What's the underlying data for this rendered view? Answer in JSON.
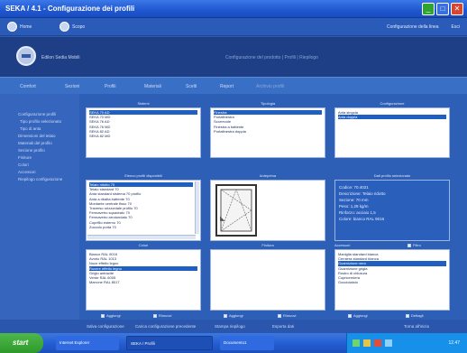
{
  "window": {
    "title": "SEKA / 4.1 - Configurazione dei profili"
  },
  "toolbar": {
    "items": [
      "Home",
      "Scopo"
    ],
    "right": [
      "Configurazione della linea",
      "Esci"
    ]
  },
  "header": {
    "brand": "Edilon Sedia Mobili",
    "info": "Configurazione del prodotto  |  Profili  |  Riepilogo"
  },
  "menu": {
    "items": [
      "Comfort",
      "Sezioni",
      "Profili",
      "Materiali",
      "Scelti",
      "Report",
      "Archivio profili"
    ]
  },
  "sidebar": {
    "items": [
      "Configurazione profili",
      "Tipo profilo selezionato",
      "Tipo di anta",
      "Dimensioni del telaio",
      "Materiali del profilo",
      "Sezione profilo",
      "Finiture",
      "Colori",
      "Accessori",
      "Riepilogo configurazione"
    ]
  },
  "panels": {
    "p1": {
      "label": "Sistemi",
      "items": [
        "SEKA 70 AD",
        "SEKA 70 MD",
        "SEKA 76 AD",
        "SEKA 76 MD",
        "SEKA 82 AD",
        "SEKA 82 MD"
      ],
      "selected": 0
    },
    "p2": {
      "label": "Tipologia",
      "items": [
        "Finestra",
        "Portafinestra",
        "Scorrevole",
        "Finestra a battente",
        "Portafinestra doppia"
      ],
      "selected": 0
    },
    "p3": {
      "label": "Configurazione",
      "items": [
        "Anta singola",
        "Anta doppia"
      ],
      "selected": 1
    },
    "p4": {
      "label": "Elenco profili disponibili",
      "items": [
        "Telaio ridotto 70",
        "Telaio standard 70",
        "Anta standard sistema 70 profilo",
        "Anta a ribalta battente 70",
        "Montante centrale fisso 70",
        "Traverso orizzontale profilo 70",
        "Fermavetro squadrato 70",
        "Fermavetro arrotondato 70",
        "Coprifilo esterno 70",
        "Zoccolo porta 70"
      ],
      "selected": 0
    },
    "p5": {
      "label": "Anteprima",
      "glyph": "◣"
    },
    "p6": {
      "label": "Dati profilo selezionato",
      "lines": [
        "Codice: 70.4021",
        "Descrizione: Telaio ridotto",
        "Sezione: 70 mm",
        "Peso: 1,28 kg/m",
        "Rinforzo: acciaio 1,5",
        "Colore: bianco RAL 9016"
      ]
    },
    "p7": {
      "label": "Colori",
      "items": [
        "Bianco RAL 9016",
        "Avorio RAL 1013",
        "Noce effetto legno",
        "Rovere effetto legno",
        "Grigio antracite",
        "Verde RAL 6005",
        "Marrone RAL 8017"
      ],
      "selected": 3
    },
    "p8": {
      "label": "Finitura",
      "items": []
    },
    "p9": {
      "label": "Accessori",
      "items": [
        "Maniglia standard bianca",
        "Cerniera standard bianca",
        "Guarnizione nera",
        "Guarnizione grigia",
        "Rostro di chiusura",
        "Copricerniera",
        "Gocciolatoio"
      ],
      "selected": 2
    }
  },
  "panel_buttons": {
    "add": "Aggiungi",
    "remove": "Rimuovi",
    "details": "Dettagli",
    "filter": "Filtro"
  },
  "footer": {
    "items": [
      "Salva configurazione",
      "Carica configurazione precedente",
      "Stampa riepilogo",
      "Esporta dati",
      "Torna all'inizio"
    ]
  },
  "taskbar": {
    "start": "start",
    "tasks": [
      "Internet Explorer",
      "SEKA / Profili",
      "Documento1"
    ],
    "clock": "12.47"
  },
  "colors": {
    "accent": "#1f5fc2",
    "background": "#2f5bb0",
    "panel": "#ffffff"
  }
}
